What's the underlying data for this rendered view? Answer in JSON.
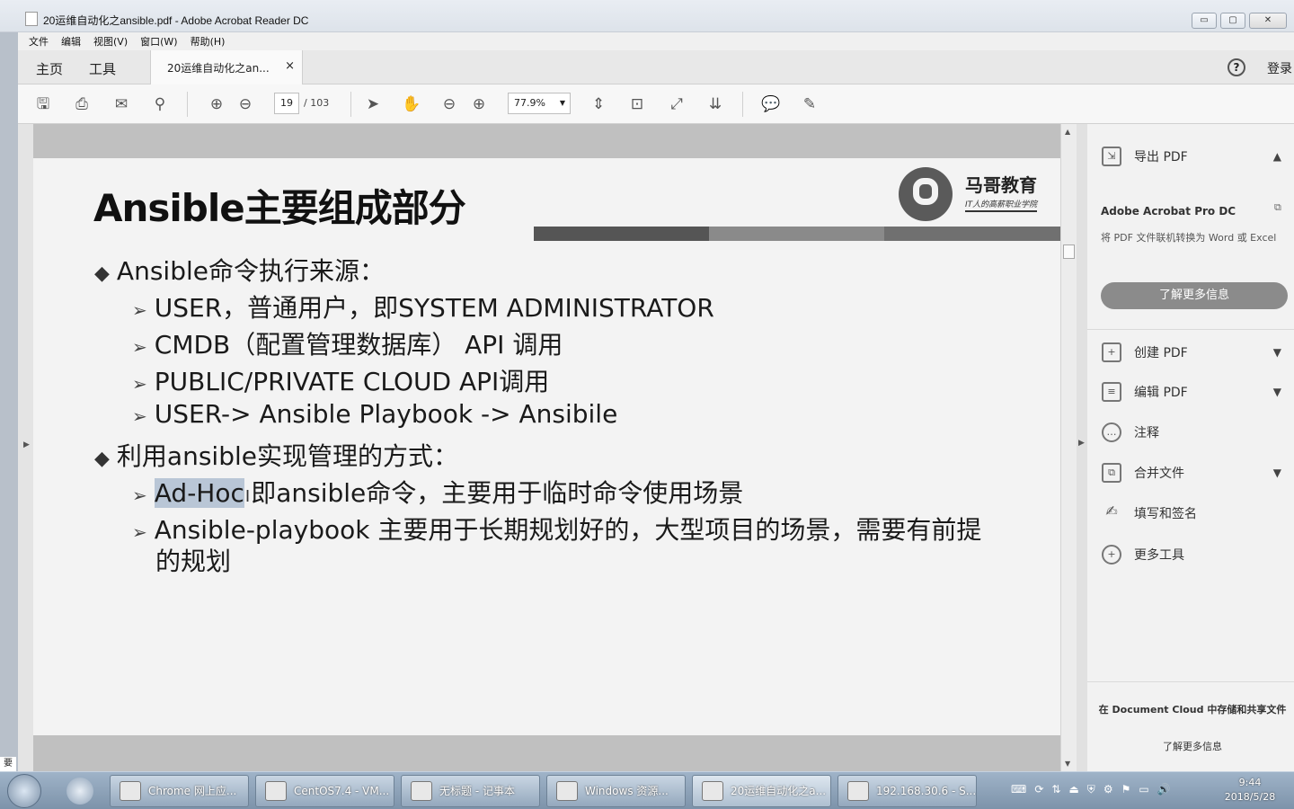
{
  "window": {
    "title": "20运维自动化之ansible.pdf - Adobe Acrobat Reader DC",
    "controls": [
      "▭",
      "▢",
      "✕"
    ]
  },
  "menu": [
    "文件",
    "编辑",
    "视图(V)",
    "窗口(W)",
    "帮助(H)"
  ],
  "tabs": {
    "home": "主页",
    "tools": "工具",
    "document": "20运维自动化之an...",
    "close": "×",
    "help": "?",
    "login": "登录"
  },
  "toolbar": {
    "page_current": "19",
    "page_total": "/ 103",
    "zoom": "77.9%",
    "icons": [
      "save-icon",
      "print-icon",
      "mail-icon",
      "search-icon",
      "page-up-icon",
      "page-down-icon",
      "select-cursor-icon",
      "hand-icon",
      "zoom-out-icon",
      "zoom-in-icon",
      "fit-page-icon",
      "fit-width-icon",
      "fullscreen-icon",
      "scroll-mode-icon",
      "comment-icon",
      "sign-icon"
    ]
  },
  "slide": {
    "title": "Ansible主要组成部分",
    "logo_name": "马哥教育",
    "logo_tagline": "IT人的高薪职业学院",
    "bullet1": "Ansible命令执行来源：",
    "sub1": "USER，普通用户，即SYSTEM ADMINISTRATOR",
    "sub2": "CMDB（配置管理数据库） API 调用",
    "sub3": "PUBLIC/PRIVATE CLOUD API调用",
    "sub4": "USER-> Ansible Playbook -> Ansibile",
    "bullet2": "利用ansible实现管理的方式：",
    "sub5_highlight": "Ad-Hoc",
    "sub5_rest": "即ansible命令，主要用于临时命令使用场景",
    "sub6_line1": "Ansible-playbook 主要用于长期规划好的，大型项目的场景，需要有前提",
    "sub6_line2": "的规划"
  },
  "right_panel": {
    "export_pdf": "导出 PDF",
    "promo_title": "Adobe Acrobat Pro DC",
    "promo_desc": "将 PDF 文件联机转换为 Word 或 Excel",
    "promo_button": "了解更多信息",
    "create_pdf": "创建 PDF",
    "edit_pdf": "编辑 PDF",
    "comment": "注释",
    "combine": "合并文件",
    "fill_sign": "填写和签名",
    "more_tools": "更多工具",
    "footer_text": "在 Document Cloud 中存储和共享文件",
    "footer_link": "了解更多信息"
  },
  "stub_text": "要",
  "taskbar": {
    "tasks": [
      "Chrome 网上应...",
      "CentOS7.4 - VM...",
      "无标题 - 记事本",
      "Windows 资源...",
      "20运维自动化之a...",
      "192.168.30.6 - S..."
    ],
    "time": "9:44",
    "date": "2018/5/28"
  }
}
